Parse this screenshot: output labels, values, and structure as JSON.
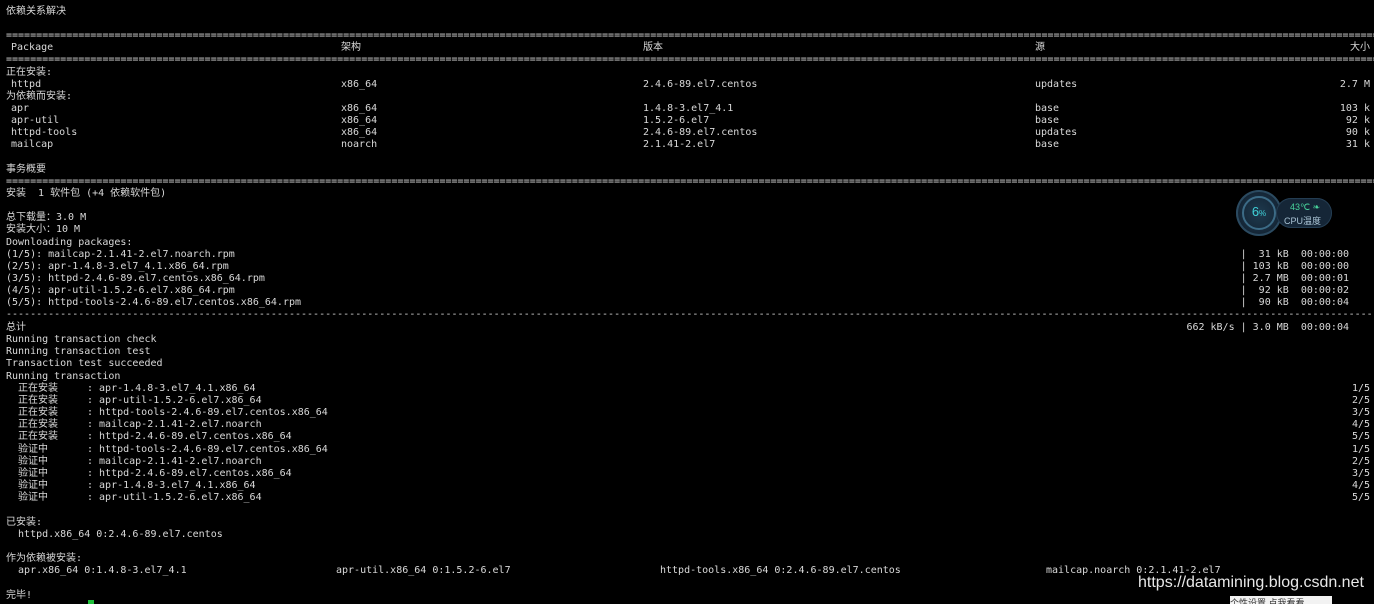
{
  "title_line": "依赖关系解决",
  "sep_eq": "==================================================================================================================================================================================================================================================================================================",
  "sep_dash": "--------------------------------------------------------------------------------------------------------------------------------------------------------------------------------------------------------------------------------------------------------------------------------------------------",
  "headers": {
    "package": "Package",
    "arch": "架构",
    "version": "版本",
    "repo": "源",
    "size": "大小"
  },
  "installing_label": "正在安装:",
  "main_pkg": {
    "name": "httpd",
    "arch": "x86_64",
    "version": "2.4.6-89.el7.centos",
    "repo": "updates",
    "size": "2.7 M"
  },
  "deps_label": "为依赖而安装:",
  "deps": [
    {
      "name": "apr",
      "arch": "x86_64",
      "version": "1.4.8-3.el7_4.1",
      "repo": "base",
      "size": "103 k"
    },
    {
      "name": "apr-util",
      "arch": "x86_64",
      "version": "1.5.2-6.el7",
      "repo": "base",
      "size": "92 k"
    },
    {
      "name": "httpd-tools",
      "arch": "x86_64",
      "version": "2.4.6-89.el7.centos",
      "repo": "updates",
      "size": "90 k"
    },
    {
      "name": "mailcap",
      "arch": "noarch",
      "version": "2.1.41-2.el7",
      "repo": "base",
      "size": "31 k"
    }
  ],
  "summary_label": "事务概要",
  "install_summary": "安装  1 软件包 (+4 依赖软件包)",
  "total_download": "总下载量：3.0 M",
  "install_size": "安装大小：10 M",
  "downloading": "Downloading packages:",
  "downloads": [
    {
      "file": "(1/5): mailcap-2.1.41-2.el7.noarch.rpm",
      "stat": "|  31 kB  00:00:00"
    },
    {
      "file": "(2/5): apr-1.4.8-3.el7_4.1.x86_64.rpm",
      "stat": "| 103 kB  00:00:00"
    },
    {
      "file": "(3/5): httpd-2.4.6-89.el7.centos.x86_64.rpm",
      "stat": "| 2.7 MB  00:00:01"
    },
    {
      "file": "(4/5): apr-util-1.5.2-6.el7.x86_64.rpm",
      "stat": "|  92 kB  00:00:02"
    },
    {
      "file": "(5/5): httpd-tools-2.4.6-89.el7.centos.x86_64.rpm",
      "stat": "|  90 kB  00:00:04"
    }
  ],
  "total_label": "总计",
  "total_stat": "662 kB/s | 3.0 MB  00:00:04",
  "tx_lines": [
    "Running transaction check",
    "Running transaction test",
    "Transaction test succeeded",
    "Running transaction"
  ],
  "steps": [
    {
      "action": "  正在安装",
      "pkg": ": apr-1.4.8-3.el7_4.1.x86_64",
      "n": "1/5"
    },
    {
      "action": "  正在安装",
      "pkg": ": apr-util-1.5.2-6.el7.x86_64",
      "n": "2/5"
    },
    {
      "action": "  正在安装",
      "pkg": ": httpd-tools-2.4.6-89.el7.centos.x86_64",
      "n": "3/5"
    },
    {
      "action": "  正在安装",
      "pkg": ": mailcap-2.1.41-2.el7.noarch",
      "n": "4/5"
    },
    {
      "action": "  正在安装",
      "pkg": ": httpd-2.4.6-89.el7.centos.x86_64",
      "n": "5/5"
    },
    {
      "action": "  验证中",
      "pkg": ": httpd-tools-2.4.6-89.el7.centos.x86_64",
      "n": "1/5"
    },
    {
      "action": "  验证中",
      "pkg": ": mailcap-2.1.41-2.el7.noarch",
      "n": "2/5"
    },
    {
      "action": "  验证中",
      "pkg": ": httpd-2.4.6-89.el7.centos.x86_64",
      "n": "3/5"
    },
    {
      "action": "  验证中",
      "pkg": ": apr-1.4.8-3.el7_4.1.x86_64",
      "n": "4/5"
    },
    {
      "action": "  验证中",
      "pkg": ": apr-util-1.5.2-6.el7.x86_64",
      "n": "5/5"
    }
  ],
  "installed_label": "已安装:",
  "installed_pkg": "  httpd.x86_64 0:2.4.6-89.el7.centos",
  "dep_installed_label": "作为依赖被安装:",
  "dep_installed": [
    "  apr.x86_64 0:1.4.8-3.el7_4.1",
    "apr-util.x86_64 0:1.5.2-6.el7",
    "httpd-tools.x86_64 0:2.4.6-89.el7.centos",
    "mailcap.noarch 0:2.1.41-2.el7"
  ],
  "done": "完毕!",
  "cpu_widget": {
    "percent": "6",
    "percent_unit": "%",
    "temp": "43℃",
    "label": "CPU温度",
    "accent": "#3fd1d8",
    "temp_color": "#47d19a"
  },
  "watermark": "https://datamining.blog.csdn.net",
  "popup_text": "个性设置   点我看看"
}
